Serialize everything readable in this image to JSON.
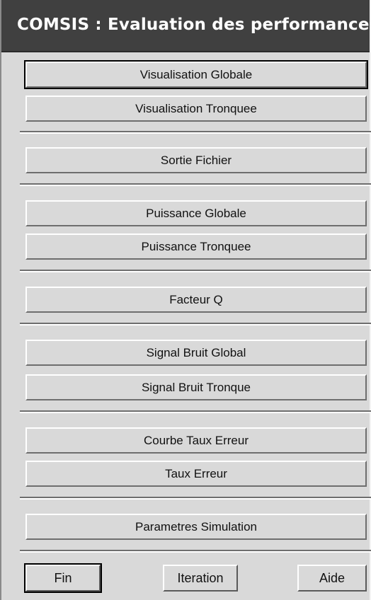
{
  "window": {
    "title": "COMSIS : Evaluation des performances"
  },
  "groups": [
    {
      "buttons": [
        "Visualisation Globale",
        "Visualisation Tronquee"
      ]
    },
    {
      "buttons": [
        "Sortie Fichier"
      ]
    },
    {
      "buttons": [
        "Puissance Globale",
        "Puissance Tronquee"
      ]
    },
    {
      "buttons": [
        "Facteur Q"
      ]
    },
    {
      "buttons": [
        "Signal Bruit Global",
        "Signal Bruit Tronque"
      ]
    },
    {
      "buttons": [
        "Courbe Taux Erreur",
        "Taux Erreur"
      ]
    },
    {
      "buttons": [
        "Parametres Simulation"
      ]
    }
  ],
  "footer": {
    "fin": "Fin",
    "iteration": "Iteration",
    "aide": "Aide"
  }
}
